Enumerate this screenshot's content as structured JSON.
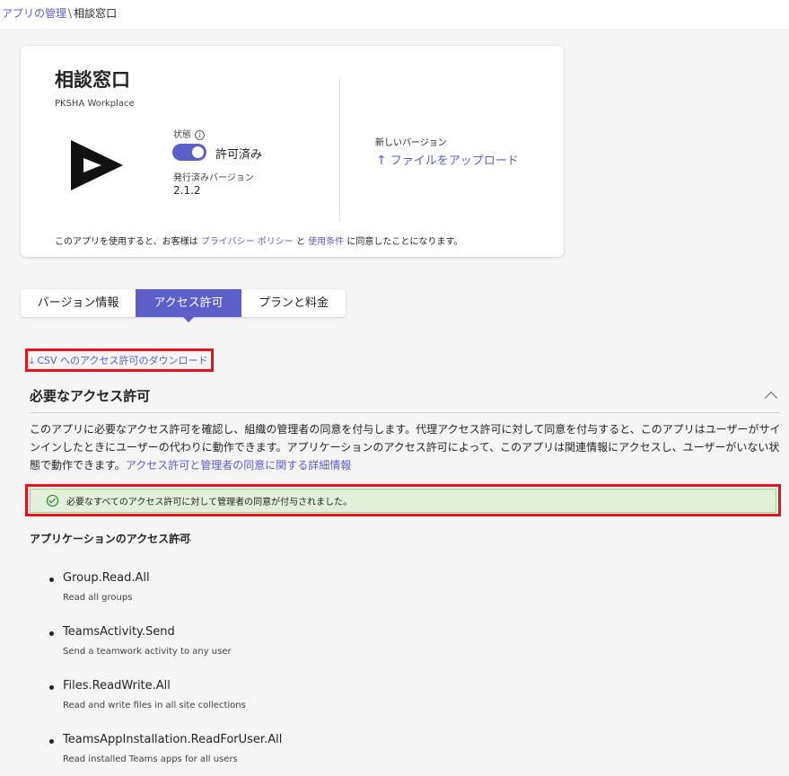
{
  "breadcrumb": {
    "parent": "アプリの管理",
    "separator": "\\",
    "current": "相談窓口"
  },
  "app": {
    "title": "相談窓口",
    "vendor": "PKSHA Workplace",
    "status_label": "状態",
    "status_value": "許可済み",
    "status_enabled": true,
    "published_version_label": "発行済みバージョン",
    "published_version": "2.1.2",
    "new_version_label": "新しいバージョン",
    "upload_label": "ファイルをアップロード",
    "consent_prefix": "このアプリを使用すると、お客様は",
    "privacy_link": "プライバシー ポリシー",
    "consent_and": "と",
    "terms_link": "使用条件",
    "consent_suffix": "に同意したことになります。"
  },
  "tabs": [
    {
      "label": "バージョン情報",
      "active": false
    },
    {
      "label": "アクセス許可",
      "active": true
    },
    {
      "label": "プランと料金",
      "active": false
    }
  ],
  "permissions": {
    "csv_download": "CSV へのアクセス許可のダウンロード",
    "section_title": "必要なアクセス許可",
    "description": "このアプリに必要なアクセス許可を確認し、組織の管理者の同意を付与します。代理アクセス許可に対して同意を付与すると、このアプリはユーザーがサインインしたときにユーザーの代わりに動作できます。アプリケーションのアクセス許可によって、このアプリは関連情報にアクセスし、ユーザーがいない状態で動作できます。",
    "description_link": "アクセス許可と管理者の同意に関する詳細情報",
    "success_message": "必要なすべてのアクセス許可に対して管理者の同意が付与されました。",
    "app_permissions_title": "アプリケーションのアクセス許可",
    "items": [
      {
        "name": "Group.Read.All",
        "description": "Read all groups"
      },
      {
        "name": "TeamsActivity.Send",
        "description": "Send a teamwork activity to any user"
      },
      {
        "name": "Files.ReadWrite.All",
        "description": "Read and write files in all site collections"
      },
      {
        "name": "TeamsAppInstallation.ReadForUser.All",
        "description": "Read installed Teams apps for all users"
      }
    ]
  },
  "colors": {
    "accent": "#5b5fc7",
    "highlight_box": "#e8121b",
    "success_bg": "#e2f0d9",
    "success_icon": "#107c10"
  }
}
